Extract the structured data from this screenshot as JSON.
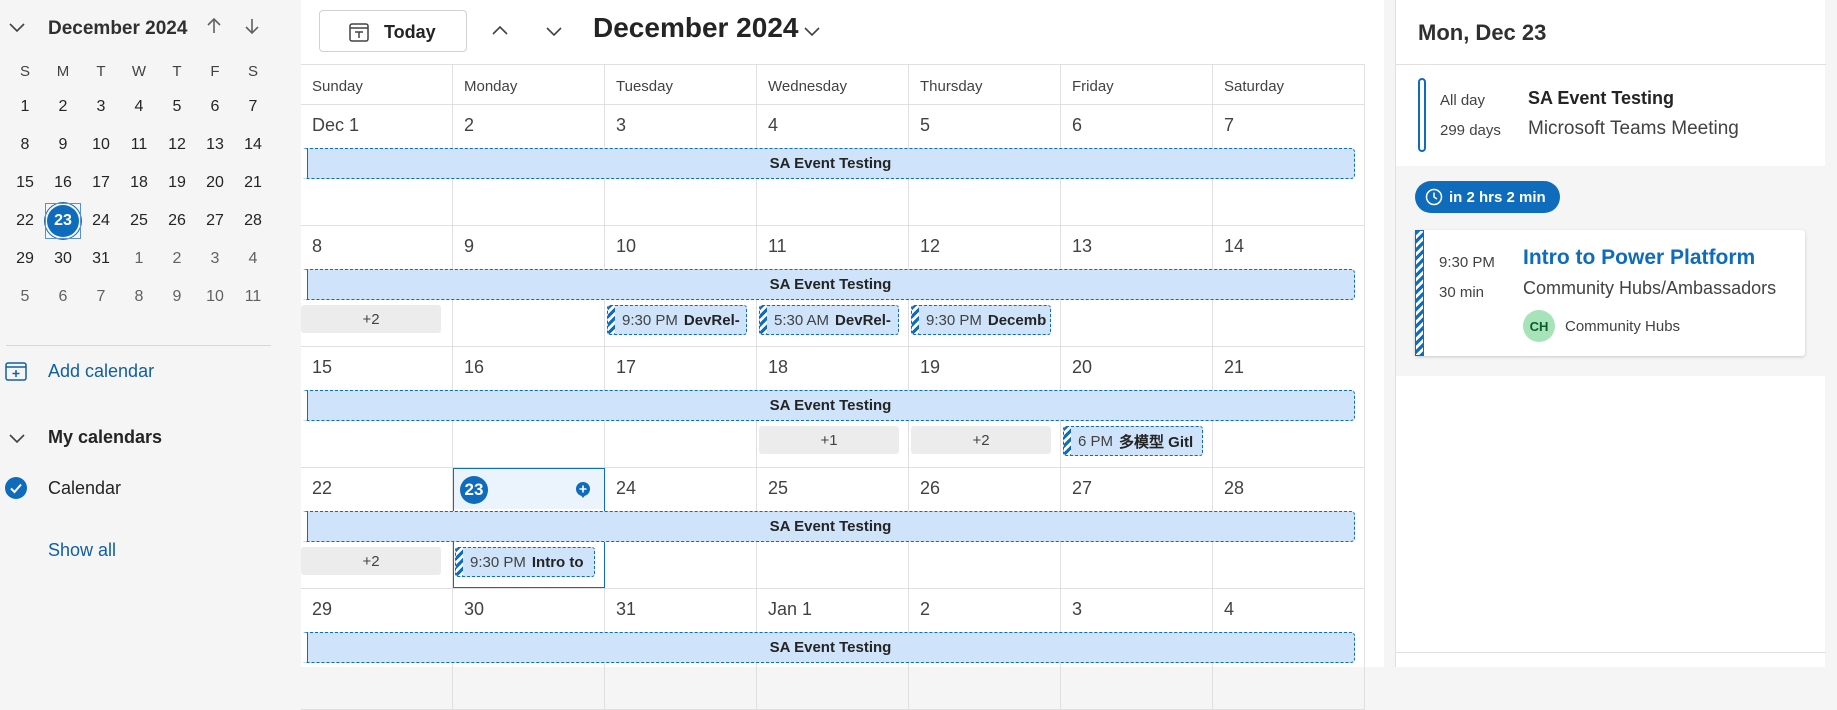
{
  "mini_calendar": {
    "month_title": "December 2024",
    "weekdays": [
      "S",
      "M",
      "T",
      "W",
      "T",
      "F",
      "S"
    ],
    "weeks": [
      [
        "1",
        "2",
        "3",
        "4",
        "5",
        "6",
        "7"
      ],
      [
        "8",
        "9",
        "10",
        "11",
        "12",
        "13",
        "14"
      ],
      [
        "15",
        "16",
        "17",
        "18",
        "19",
        "20",
        "21"
      ],
      [
        "22",
        "23",
        "24",
        "25",
        "26",
        "27",
        "28"
      ],
      [
        "29",
        "30",
        "31",
        "1",
        "2",
        "3",
        "4"
      ],
      [
        "5",
        "6",
        "7",
        "8",
        "9",
        "10",
        "11"
      ]
    ],
    "today": "23"
  },
  "left_nav": {
    "add_calendar": "Add calendar",
    "my_calendars": "My calendars",
    "calendar_item": "Calendar",
    "show_all": "Show all"
  },
  "toolbar": {
    "today_label": "Today",
    "title": "December 2024"
  },
  "month_view": {
    "weekday_headers": [
      "Sunday",
      "Monday",
      "Tuesday",
      "Wednesday",
      "Thursday",
      "Friday",
      "Saturday"
    ],
    "weeks": [
      {
        "days": [
          "Dec 1",
          "2",
          "3",
          "4",
          "5",
          "6",
          "7"
        ],
        "all_day": "SA Event Testing"
      },
      {
        "days": [
          "8",
          "9",
          "10",
          "11",
          "12",
          "13",
          "14"
        ],
        "all_day": "SA Event Testing",
        "more": [
          "+2"
        ],
        "events": [
          {
            "time": "9:30 PM",
            "name": "DevRel-"
          },
          {
            "time": "5:30 AM",
            "name": "DevRel-"
          },
          {
            "time": "9:30 PM",
            "name": "Decemb"
          }
        ]
      },
      {
        "days": [
          "15",
          "16",
          "17",
          "18",
          "19",
          "20",
          "21"
        ],
        "all_day": "SA Event Testing",
        "more": [
          "+1",
          "+2"
        ],
        "events": [
          {
            "time": "6 PM",
            "name": "多模型 Gitl"
          }
        ]
      },
      {
        "days": [
          "22",
          "23",
          "24",
          "25",
          "26",
          "27",
          "28"
        ],
        "all_day": "SA Event Testing",
        "more": [
          "+2"
        ],
        "events": [
          {
            "time": "9:30 PM",
            "name": "Intro to"
          }
        ]
      },
      {
        "days": [
          "29",
          "30",
          "31",
          "Jan 1",
          "2",
          "3",
          "4"
        ],
        "all_day": "SA Event Testing"
      }
    ]
  },
  "agenda": {
    "date_title": "Mon, Dec 23",
    "all_day_event": {
      "label": "All day",
      "span": "299 days",
      "title": "SA Event Testing",
      "subtitle": "Microsoft Teams Meeting"
    },
    "countdown": "in 2 hrs 2 min",
    "next_event": {
      "time": "9:30 PM",
      "duration": "30 min",
      "title": "Intro to Power Platform",
      "location": "Community Hubs/Ambassadors",
      "organizer_initials": "CH",
      "organizer": "Community Hubs"
    }
  },
  "colors": {
    "accent": "#0f6cbd",
    "event_fill": "#cfe4fa",
    "avatar_fill": "#a7e3b8"
  }
}
